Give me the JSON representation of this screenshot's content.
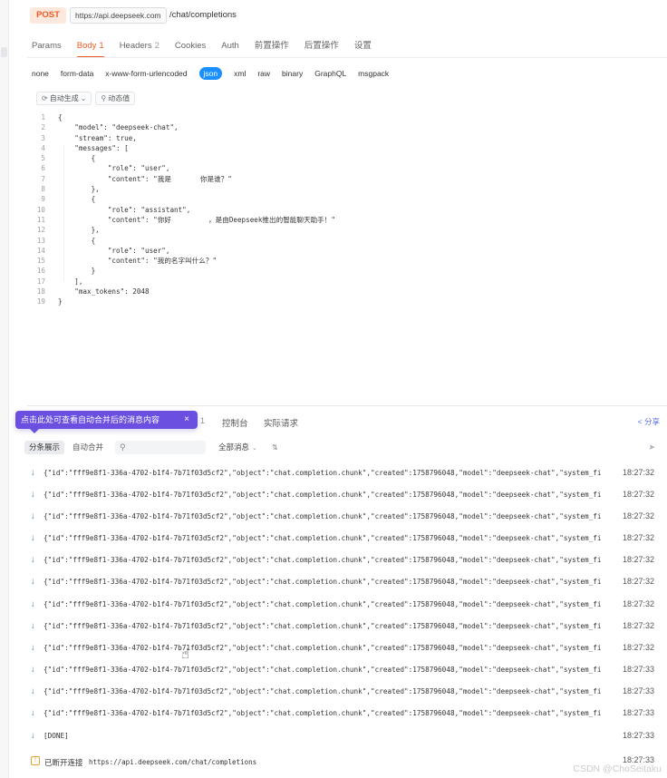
{
  "request": {
    "method": "POST",
    "base_url": "https://api.deepseek.com",
    "path": "/chat/completions"
  },
  "tabs": [
    {
      "label": "Params",
      "count": ""
    },
    {
      "label": "Body",
      "count": "1"
    },
    {
      "label": "Headers",
      "count": "2"
    },
    {
      "label": "Cookies",
      "count": ""
    },
    {
      "label": "Auth",
      "count": ""
    },
    {
      "label": "前置操作",
      "count": ""
    },
    {
      "label": "后置操作",
      "count": ""
    },
    {
      "label": "设置",
      "count": ""
    }
  ],
  "active_tab": "Body",
  "body_types": [
    "none",
    "form-data",
    "x-www-form-urlencoded",
    "json",
    "xml",
    "raw",
    "binary",
    "GraphQL",
    "msgpack"
  ],
  "active_body_type": "json",
  "editor_toolbar": {
    "auto_generate": "自动生成",
    "auto_generate_caret": "⌄",
    "dynamic_value": "动态值"
  },
  "code_lines": [
    {
      "n": "1",
      "t": "{"
    },
    {
      "n": "2",
      "t": "    \"model\": \"deepseek-chat\","
    },
    {
      "n": "3",
      "t": "    \"stream\": true,"
    },
    {
      "n": "4",
      "t": "    \"messages\": ["
    },
    {
      "n": "5",
      "t": "        {"
    },
    {
      "n": "6",
      "t": "            \"role\": \"user\","
    },
    {
      "n": "7",
      "t": "            \"content\": \"我是       你是谁？\""
    },
    {
      "n": "8",
      "t": "        },"
    },
    {
      "n": "9",
      "t": "        {"
    },
    {
      "n": "10",
      "t": "            \"role\": \"assistant\","
    },
    {
      "n": "11",
      "t": "            \"content\": \"你好         ，是由Deepseek推出的智能聊天助手！\""
    },
    {
      "n": "12",
      "t": "        },"
    },
    {
      "n": "13",
      "t": "        {"
    },
    {
      "n": "14",
      "t": "            \"role\": \"user\","
    },
    {
      "n": "15",
      "t": "            \"content\": \"我的名字叫什么？\""
    },
    {
      "n": "16",
      "t": "        }"
    },
    {
      "n": "17",
      "t": "    ],"
    },
    {
      "n": "18",
      "t": "    \"max_tokens\": 2048"
    },
    {
      "n": "19",
      "t": "}"
    }
  ],
  "response": {
    "tooltip": "点击此处可查看自动合并后的消息内容",
    "tooltip_close": "×",
    "tab_count": "1",
    "tab_console": "控制台",
    "tab_actual_request": "实际请求",
    "share": "分享",
    "seg_split": "分条展示",
    "seg_merge": "自动合并",
    "search_placeholder": "",
    "filter": "全部消息",
    "messages": [
      {
        "text": "{\"id\":\"fff9e8f1-336a-4702-b1f4-7b71f03d5cf2\",\"object\":\"chat.completion.chunk\",\"created\":1758796048,\"model\":\"deepseek-chat\",\"system_fi",
        "time": "18:27:32"
      },
      {
        "text": "{\"id\":\"fff9e8f1-336a-4702-b1f4-7b71f03d5cf2\",\"object\":\"chat.completion.chunk\",\"created\":1758796048,\"model\":\"deepseek-chat\",\"system_fi",
        "time": "18:27:32"
      },
      {
        "text": "{\"id\":\"fff9e8f1-336a-4702-b1f4-7b71f03d5cf2\",\"object\":\"chat.completion.chunk\",\"created\":1758796048,\"model\":\"deepseek-chat\",\"system_fi",
        "time": "18:27:32"
      },
      {
        "text": "{\"id\":\"fff9e8f1-336a-4702-b1f4-7b71f03d5cf2\",\"object\":\"chat.completion.chunk\",\"created\":1758796048,\"model\":\"deepseek-chat\",\"system_fi",
        "time": "18:27:32"
      },
      {
        "text": "{\"id\":\"fff9e8f1-336a-4702-b1f4-7b71f03d5cf2\",\"object\":\"chat.completion.chunk\",\"created\":1758796048,\"model\":\"deepseek-chat\",\"system_fi",
        "time": "18:27:32"
      },
      {
        "text": "{\"id\":\"fff9e8f1-336a-4702-b1f4-7b71f03d5cf2\",\"object\":\"chat.completion.chunk\",\"created\":1758796048,\"model\":\"deepseek-chat\",\"system_fi",
        "time": "18:27:32"
      },
      {
        "text": "{\"id\":\"fff9e8f1-336a-4702-b1f4-7b71f03d5cf2\",\"object\":\"chat.completion.chunk\",\"created\":1758796048,\"model\":\"deepseek-chat\",\"system_fi",
        "time": "18:27:32"
      },
      {
        "text": "{\"id\":\"fff9e8f1-336a-4702-b1f4-7b71f03d5cf2\",\"object\":\"chat.completion.chunk\",\"created\":1758796048,\"model\":\"deepseek-chat\",\"system_fi",
        "time": "18:27:32"
      },
      {
        "text": "{\"id\":\"fff9e8f1-336a-4702-b1f4-7b71f03d5cf2\",\"object\":\"chat.completion.chunk\",\"created\":1758796048,\"model\":\"deepseek-chat\",\"system_fi",
        "time": "18:27:32"
      },
      {
        "text": "{\"id\":\"fff9e8f1-336a-4702-b1f4-7b71f03d5cf2\",\"object\":\"chat.completion.chunk\",\"created\":1758796048,\"model\":\"deepseek-chat\",\"system_fi",
        "time": "18:27:33"
      },
      {
        "text": "{\"id\":\"fff9e8f1-336a-4702-b1f4-7b71f03d5cf2\",\"object\":\"chat.completion.chunk\",\"created\":1758796048,\"model\":\"deepseek-chat\",\"system_fi",
        "time": "18:27:33"
      },
      {
        "text": "{\"id\":\"fff9e8f1-336a-4702-b1f4-7b71f03d5cf2\",\"object\":\"chat.completion.chunk\",\"created\":1758796048,\"model\":\"deepseek-chat\",\"system_fi",
        "time": "18:27:33"
      },
      {
        "text": "[DONE]",
        "time": "18:27:33"
      }
    ],
    "disconnect_label": "已断开连接",
    "disconnect_url": "https://api.deepseek.com/chat/completions",
    "disconnect_time": "18:27:33"
  },
  "watermark": "CSDN @ChoSeitaku",
  "colors": {
    "accent": "#ef5a24",
    "json_pill": "#1a8fff",
    "tooltip": "#6b4fe0"
  }
}
